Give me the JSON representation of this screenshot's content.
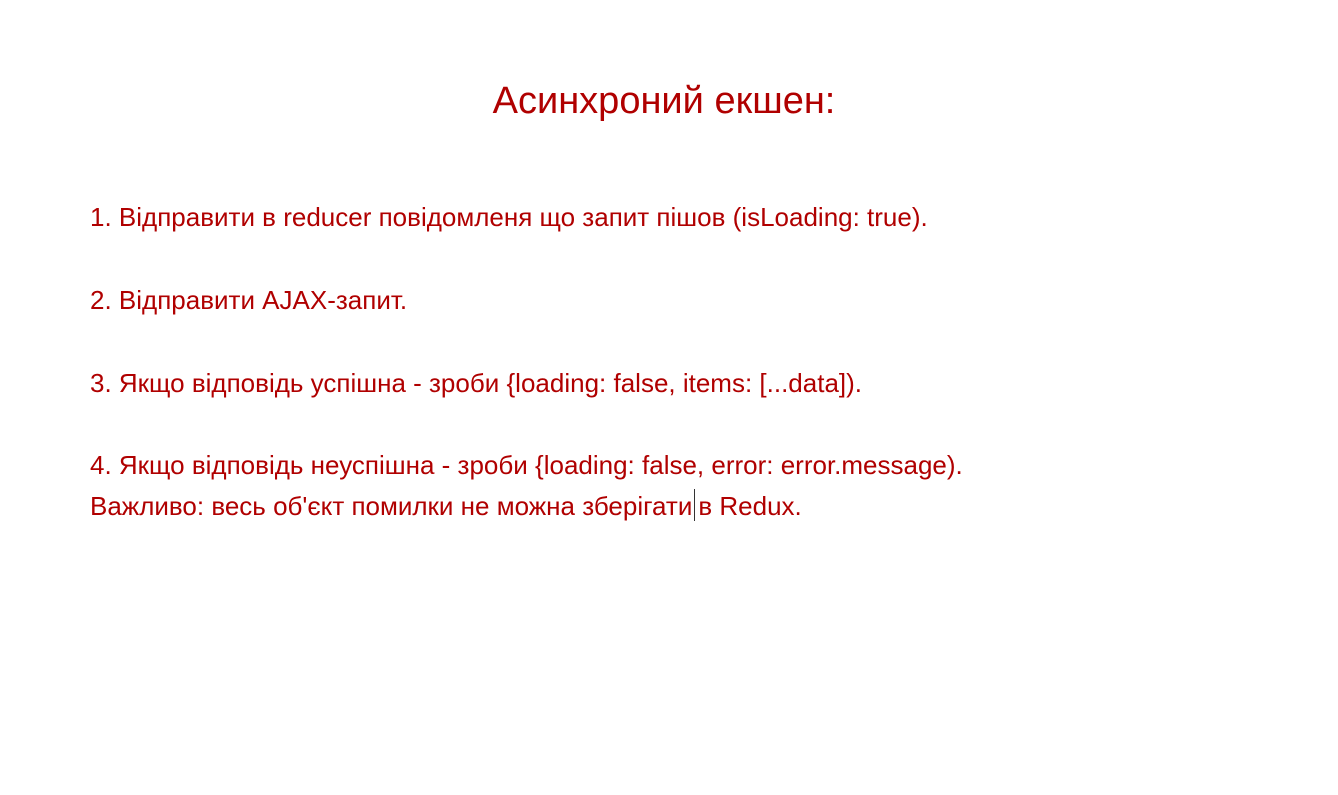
{
  "slide": {
    "title": "Асинхроний екшен:",
    "lines": [
      "1. Відправити в reducer повідомленя що запит пішов (isLoading: true).",
      "2. Відправити AJAX-запит.",
      "3. Якщо відповідь успішна - зроби {loading: false, items: [...data]).",
      "4. Якщо відповідь неуспішна - зроби {loading: false, error: error.message).",
      "Важливо: весь об'єкт помилки не можна зберігати",
      "в Redux."
    ]
  },
  "colors": {
    "text": "#b00000",
    "background": "#ffffff",
    "caret": "#333333"
  }
}
